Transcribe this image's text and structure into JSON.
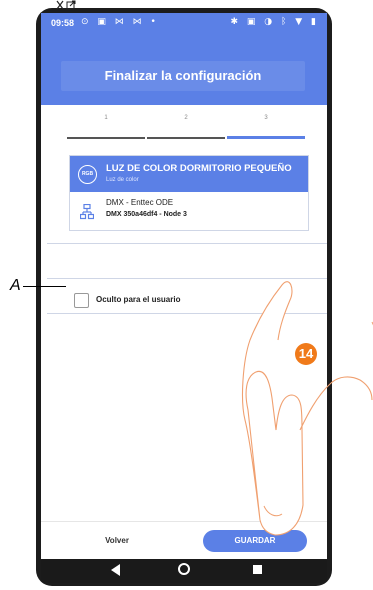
{
  "status_bar": {
    "time": "09:58",
    "left_icons": "⊙ ▣ ⋈ ⋈ •",
    "right_icons": "✱ ▣ ◑ ᛒ ▼ ▮"
  },
  "header": {
    "title": "Finalizar la configuración"
  },
  "stepper": {
    "steps": [
      "1",
      "2",
      "3"
    ],
    "active_step": 3
  },
  "device": {
    "badge": "RGB",
    "name": "LUZ DE COLOR DORMITORIO PEQUEÑO",
    "type": "Luz de color",
    "gateway_name": "DMX - Enttec ODE",
    "gateway_detail": "DMX 350a46df4 - Node 3"
  },
  "option": {
    "label": "Oculto para el usuario",
    "checked": false
  },
  "buttons": {
    "back": "Volver",
    "save": "GUARDAR"
  },
  "annotations": {
    "callout_a": "A",
    "step_number": "14"
  },
  "colors": {
    "accent": "#5b80e6",
    "step_badge": "#f07a1a"
  }
}
